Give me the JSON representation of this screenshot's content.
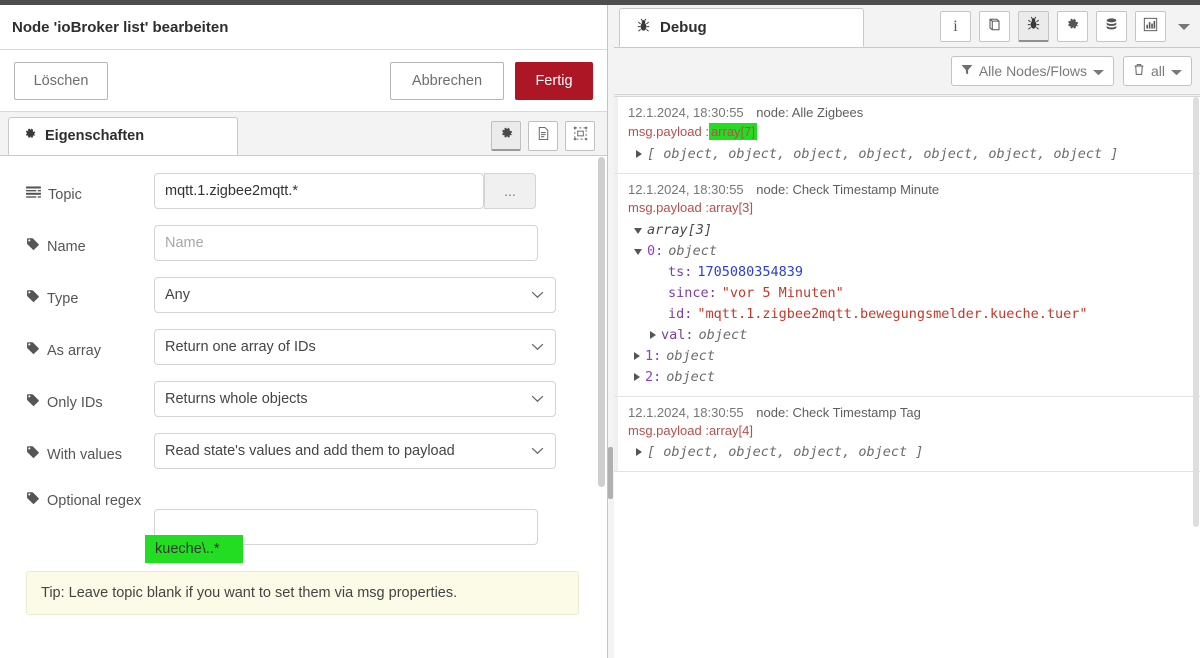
{
  "dialog": {
    "title": "Node 'ioBroker list' bearbeiten",
    "buttons": {
      "delete": "Löschen",
      "cancel": "Abbrechen",
      "done": "Fertig"
    },
    "tab": {
      "label": "Eigenschaften",
      "icon": "gear-icon"
    },
    "tab_tools": [
      {
        "name": "appearance-gear-icon",
        "active": true
      },
      {
        "name": "description-doc-icon",
        "active": false
      },
      {
        "name": "node-outline-icon",
        "active": false
      }
    ],
    "fields": [
      {
        "label": "Topic",
        "icon": "list-bars-icon",
        "type": "text",
        "value": "mqtt.1.zigbee2mqtt.*",
        "placeholder": "",
        "suffix_button": "..."
      },
      {
        "label": "Name",
        "icon": "tag-icon",
        "type": "text",
        "value": "",
        "placeholder": "Name"
      },
      {
        "label": "Type",
        "icon": "tag-icon",
        "type": "select",
        "value": "Any"
      },
      {
        "label": "As array",
        "icon": "tag-icon",
        "type": "select",
        "value": "Return one array of IDs"
      },
      {
        "label": "Only IDs",
        "icon": "tag-icon",
        "type": "select",
        "value": "Returns whole objects"
      },
      {
        "label": "With values",
        "icon": "tag-icon",
        "type": "select",
        "value": "Read state's values and add them to payload"
      },
      {
        "label": "Optional regex",
        "icon": "tag-icon",
        "type": "text",
        "value": "kueche\\..*",
        "placeholder": "",
        "highlighted": true
      }
    ],
    "tip": "Tip: Leave topic blank if you want to set them via msg properties."
  },
  "debug": {
    "tab_label": "Debug",
    "tab_icon": "bug-icon",
    "tools": [
      {
        "name": "info-icon",
        "glyph": "i",
        "active": false
      },
      {
        "name": "book-icon",
        "glyph": "book",
        "active": false
      },
      {
        "name": "bug-icon",
        "glyph": "bug",
        "active": true
      },
      {
        "name": "gear-icon",
        "glyph": "gear",
        "active": false
      },
      {
        "name": "database-icon",
        "glyph": "db",
        "active": false
      },
      {
        "name": "chart-bars-icon",
        "glyph": "chart",
        "active": false
      }
    ],
    "filter": {
      "nodes_label": "Alle Nodes/Flows",
      "clear_label": "all"
    },
    "messages": [
      {
        "timestamp": "12.1.2024, 18:30:55",
        "node": "node: Alle Zigbees",
        "prop_label": "msg.payload : ",
        "prop_value": "array[7]",
        "prop_highlighted": true,
        "collapsed_preview": "[ object, object, object, object, object, object, object ]",
        "expanded": false
      },
      {
        "timestamp": "12.1.2024, 18:30:55",
        "node": "node: Check Timestamp Minute",
        "prop_label": "msg.payload : ",
        "prop_value": "array[3]",
        "prop_highlighted": false,
        "expanded": true,
        "root_label": "array[3]",
        "tree": [
          {
            "indent": 1,
            "marker": "down",
            "key": "0:",
            "key_style": "index",
            "value": "object",
            "value_style": "obj"
          },
          {
            "indent": 3,
            "marker": "none",
            "key": "ts:",
            "key_style": "prop",
            "value": "1705080354839",
            "value_style": "num"
          },
          {
            "indent": 3,
            "marker": "none",
            "key": "since:",
            "key_style": "prop",
            "value": "\"vor 5 Minuten\"",
            "value_style": "str"
          },
          {
            "indent": 3,
            "marker": "none",
            "key": "id:",
            "key_style": "prop",
            "value": "\"mqtt.1.zigbee2mqtt.bewegungsmelder.kueche.tuer\"",
            "value_style": "str"
          },
          {
            "indent": 2,
            "marker": "right",
            "key": "val:",
            "key_style": "prop",
            "value": "object",
            "value_style": "obj"
          },
          {
            "indent": 1,
            "marker": "right",
            "key": "1:",
            "key_style": "index",
            "value": "object",
            "value_style": "obj"
          },
          {
            "indent": 1,
            "marker": "right",
            "key": "2:",
            "key_style": "index",
            "value": "object",
            "value_style": "obj"
          }
        ]
      },
      {
        "timestamp": "12.1.2024, 18:30:55",
        "node": "node: Check Timestamp Tag",
        "prop_label": "msg.payload : ",
        "prop_value": "array[4]",
        "prop_highlighted": false,
        "collapsed_preview": "[ object, object, object, object ]",
        "expanded": false
      }
    ]
  },
  "colors": {
    "accent_red": "#ad1625",
    "highlight_green": "#22dd22",
    "string_red": "#c0392b",
    "number_blue": "#2b3fd0"
  }
}
